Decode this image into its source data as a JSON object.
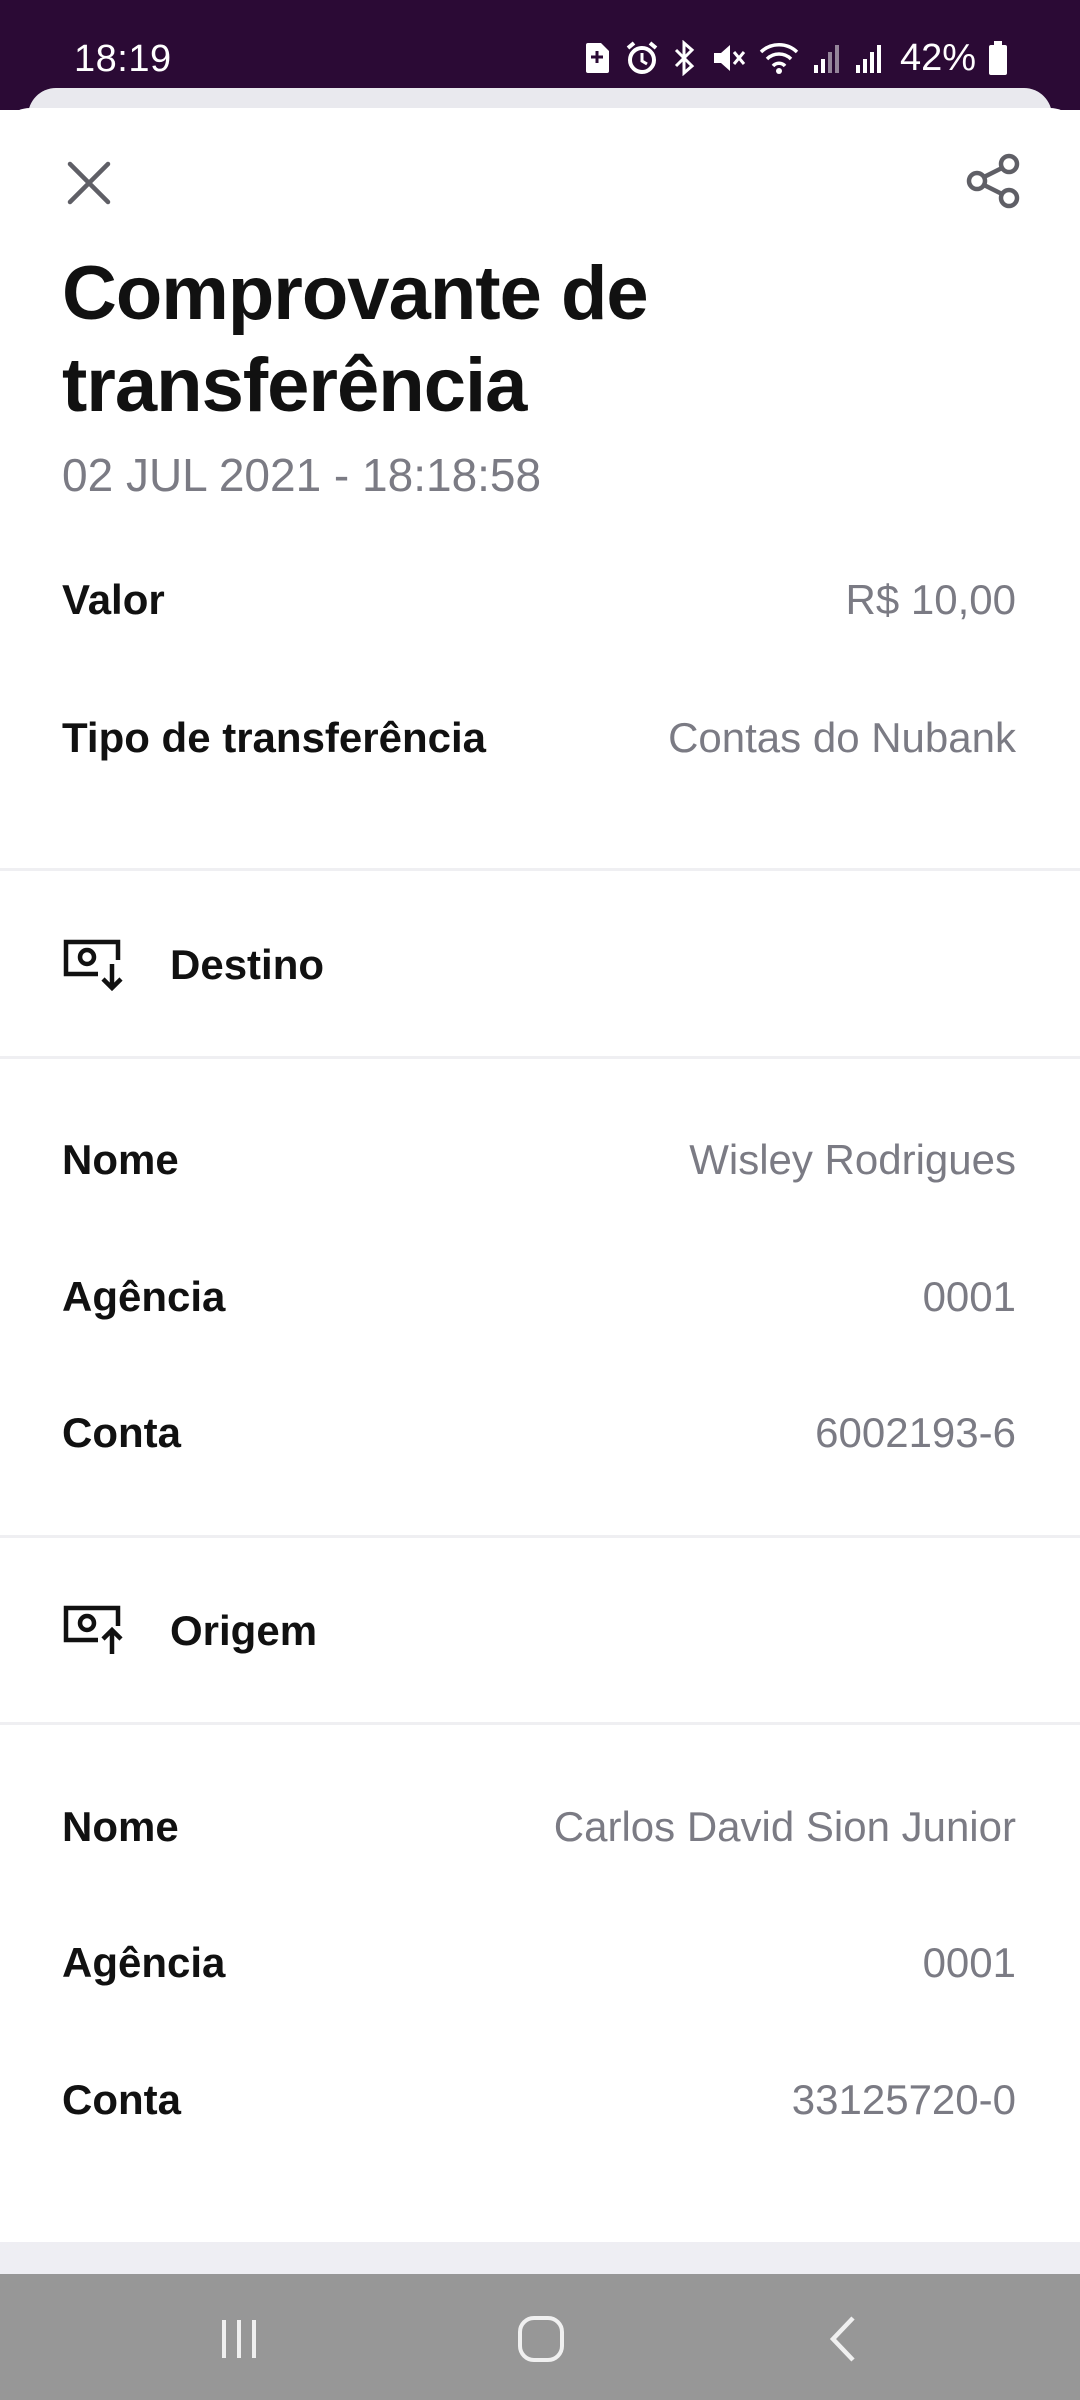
{
  "status_bar": {
    "time": "18:19",
    "battery": "42%",
    "icons": [
      "sd-card-icon",
      "alarm-icon",
      "bluetooth-icon",
      "mute-icon",
      "wifi-icon",
      "signal-icon",
      "signal-icon",
      "battery-icon"
    ]
  },
  "header": {
    "close_icon": "close-icon",
    "share_icon": "share-icon",
    "title": "Comprovante de transferência",
    "datetime": "02 JUL 2021 - 18:18:58"
  },
  "summary": [
    {
      "label": "Valor",
      "value": "R$ 10,00"
    },
    {
      "label": "Tipo de transferência",
      "value": "Contas do Nubank"
    }
  ],
  "destino": {
    "icon": "money-receive-icon",
    "title": "Destino",
    "fields": [
      {
        "label": "Nome",
        "value": "Wisley Rodrigues"
      },
      {
        "label": "Agência",
        "value": "0001"
      },
      {
        "label": "Conta",
        "value": "6002193-6"
      }
    ]
  },
  "origem": {
    "icon": "money-send-icon",
    "title": "Origem",
    "fields": [
      {
        "label": "Nome",
        "value": "Carlos David Sion Junior"
      },
      {
        "label": "Agência",
        "value": "0001"
      },
      {
        "label": "Conta",
        "value": "33125720-0"
      }
    ]
  },
  "colors": {
    "status_bar": "#2b0a35",
    "label_text": "#111111",
    "value_text": "#7b7b84",
    "nav_bar": "#979797"
  }
}
